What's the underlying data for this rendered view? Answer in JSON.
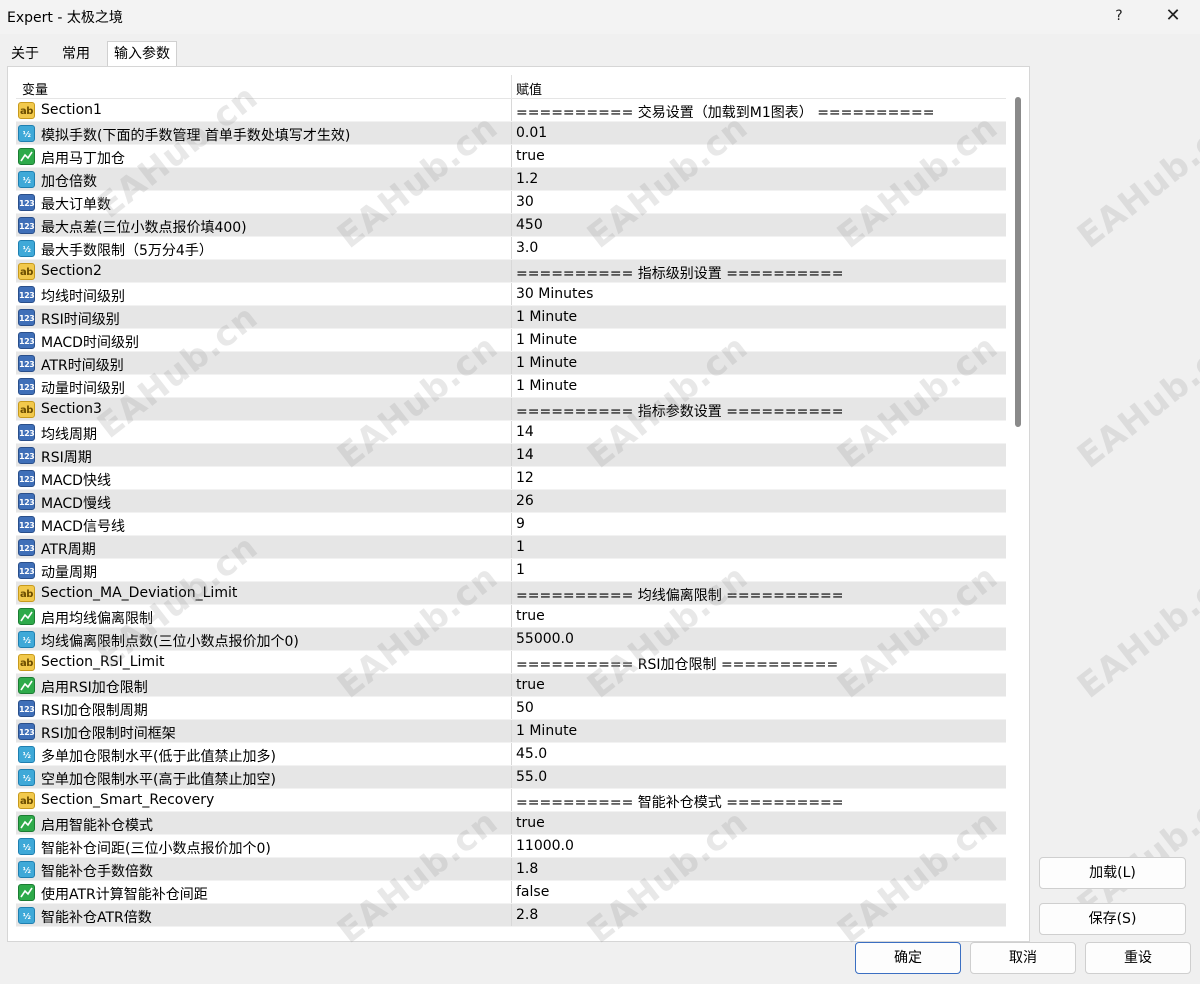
{
  "window": {
    "title": "Expert - 太极之境",
    "help": "?",
    "close": "✕"
  },
  "tabs": [
    {
      "label": "关于"
    },
    {
      "label": "常用"
    },
    {
      "label": "输入参数",
      "active": true
    }
  ],
  "grid": {
    "col_variable": "变量",
    "col_value": "赋值",
    "rows": [
      {
        "icon": "ab",
        "name": "Section1",
        "value": "========== 交易设置（加载到M1图表） =========="
      },
      {
        "icon": "half",
        "name": "模拟手数(下面的手数管理 首单手数处填写才生效)",
        "value": "0.01"
      },
      {
        "icon": "bool",
        "name": "启用马丁加仓",
        "value": "true"
      },
      {
        "icon": "half",
        "name": "加仓倍数",
        "value": "1.2"
      },
      {
        "icon": "num",
        "name": "最大订单数",
        "value": "30"
      },
      {
        "icon": "num",
        "name": "最大点差(三位小数点报价填400)",
        "value": "450"
      },
      {
        "icon": "half",
        "name": "最大手数限制（5万分4手）",
        "value": "3.0"
      },
      {
        "icon": "ab",
        "name": "Section2",
        "value": "========== 指标级别设置 =========="
      },
      {
        "icon": "num",
        "name": "均线时间级别",
        "value": "30 Minutes"
      },
      {
        "icon": "num",
        "name": "RSI时间级别",
        "value": "1 Minute"
      },
      {
        "icon": "num",
        "name": "MACD时间级别",
        "value": "1 Minute"
      },
      {
        "icon": "num",
        "name": "ATR时间级别",
        "value": "1 Minute"
      },
      {
        "icon": "num",
        "name": "动量时间级别",
        "value": "1 Minute"
      },
      {
        "icon": "ab",
        "name": "Section3",
        "value": "========== 指标参数设置 =========="
      },
      {
        "icon": "num",
        "name": "均线周期",
        "value": "14"
      },
      {
        "icon": "num",
        "name": "RSI周期",
        "value": "14"
      },
      {
        "icon": "num",
        "name": "MACD快线",
        "value": "12"
      },
      {
        "icon": "num",
        "name": "MACD慢线",
        "value": "26"
      },
      {
        "icon": "num",
        "name": "MACD信号线",
        "value": "9"
      },
      {
        "icon": "num",
        "name": "ATR周期",
        "value": "1"
      },
      {
        "icon": "num",
        "name": "动量周期",
        "value": "1"
      },
      {
        "icon": "ab",
        "name": "Section_MA_Deviation_Limit",
        "value": "========== 均线偏离限制 =========="
      },
      {
        "icon": "bool",
        "name": "启用均线偏离限制",
        "value": "true"
      },
      {
        "icon": "half",
        "name": "均线偏离限制点数(三位小数点报价加个0)",
        "value": "55000.0"
      },
      {
        "icon": "ab",
        "name": "Section_RSI_Limit",
        "value": "========== RSI加仓限制 =========="
      },
      {
        "icon": "bool",
        "name": "启用RSI加仓限制",
        "value": "true"
      },
      {
        "icon": "num",
        "name": "RSI加仓限制周期",
        "value": "50"
      },
      {
        "icon": "num",
        "name": "RSI加仓限制时间框架",
        "value": "1 Minute"
      },
      {
        "icon": "half",
        "name": "多单加仓限制水平(低于此值禁止加多)",
        "value": "45.0"
      },
      {
        "icon": "half",
        "name": "空单加仓限制水平(高于此值禁止加空)",
        "value": "55.0"
      },
      {
        "icon": "ab",
        "name": "Section_Smart_Recovery",
        "value": "========== 智能补仓模式 =========="
      },
      {
        "icon": "bool",
        "name": "启用智能补仓模式",
        "value": "true"
      },
      {
        "icon": "half",
        "name": "智能补仓间距(三位小数点报价加个0)",
        "value": "11000.0"
      },
      {
        "icon": "half",
        "name": "智能补仓手数倍数",
        "value": "1.8"
      },
      {
        "icon": "bool",
        "name": "使用ATR计算智能补仓间距",
        "value": "false"
      },
      {
        "icon": "half",
        "name": "智能补仓ATR倍数",
        "value": "2.8"
      }
    ]
  },
  "icon_glyphs": {
    "ab": "ab",
    "half": "½",
    "num": "123"
  },
  "buttons": {
    "load": "加载(L)",
    "save": "保存(S)",
    "ok": "确定",
    "cancel": "取消",
    "reset": "重设"
  },
  "watermark": "EAHub.cn"
}
